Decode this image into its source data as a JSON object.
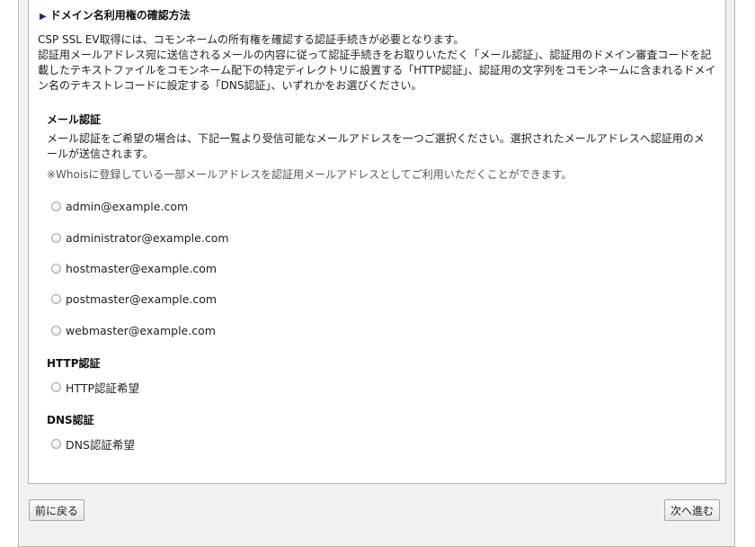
{
  "heading": {
    "marker": "▶",
    "title": "ドメイン名利用権の確認方法"
  },
  "intro": {
    "line1": "CSP SSL EV取得には、コモンネームの所有権を確認する認証手続きが必要となります。",
    "line2": "認証用メールアドレス宛に送信されるメールの内容に従って認証手続きをお取りいただく「メール認証」、認証用のドメイン審査コードを記載したテキストファイルをコモンネーム配下の特定ディレクトリに設置する「HTTP認証」、認証用の文字列をコモンネームに含まれるドメイン名のテキストレコードに設定する「DNS認証」、いずれかをお選びください。"
  },
  "mail_auth": {
    "title": "メール認証",
    "description": "メール認証をご希望の場合は、下記一覧より受信可能なメールアドレスを一つご選択ください。選択されたメールアドレスへ認証用のメールが送信されます。",
    "note": "※Whoisに登録している一部メールアドレスを認証用メールアドレスとしてご利用いただくことができます。",
    "options": [
      "admin@example.com",
      "administrator@example.com",
      "hostmaster@example.com",
      "postmaster@example.com",
      "webmaster@example.com"
    ]
  },
  "http_auth": {
    "title": "HTTP認証",
    "option": "HTTP認証希望"
  },
  "dns_auth": {
    "title": "DNS認証",
    "option": "DNS認証希望"
  },
  "buttons": {
    "back": "前に戻る",
    "next": "次へ進む"
  }
}
